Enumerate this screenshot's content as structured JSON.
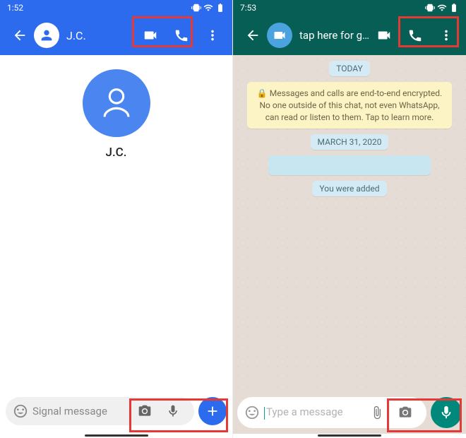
{
  "signal": {
    "status_time": "1:52",
    "contact_name": "J.C.",
    "title_name": "J.C.",
    "input_placeholder": "Signal message"
  },
  "whatsapp": {
    "status_time": "7:53",
    "header_subtitle": "tap here for group info",
    "chips": {
      "today": "TODAY",
      "date": "MARCH 31, 2020",
      "added": "You were added"
    },
    "encryption": "Messages and calls are end-to-end encrypted. No one outside of this chat, not even WhatsApp, can read or listen to them. Tap to learn more.",
    "input_placeholder": "Type a message"
  }
}
